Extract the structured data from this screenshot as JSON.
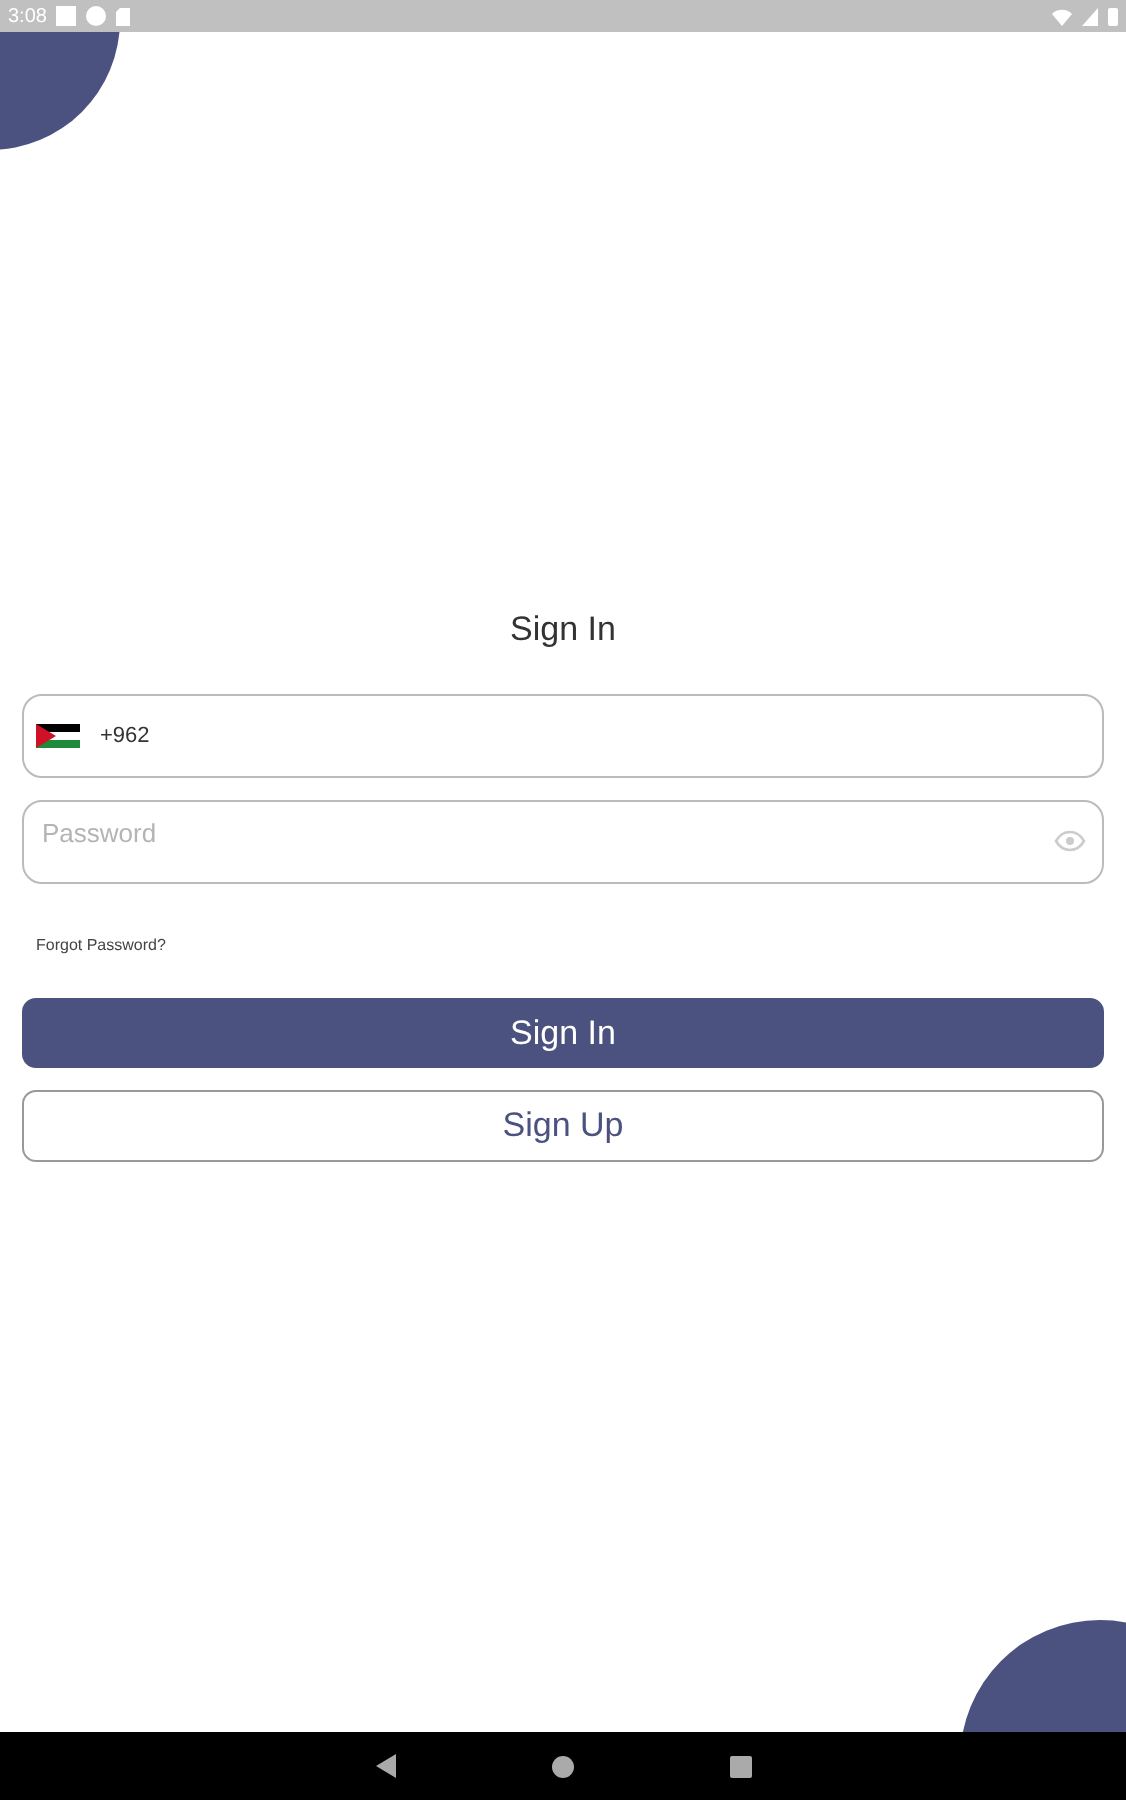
{
  "status_bar": {
    "time": "3:08"
  },
  "title": "Sign In",
  "phone_field": {
    "country_code": "+962"
  },
  "password_field": {
    "placeholder": "Password"
  },
  "forgot_link": "Forgot Password?",
  "buttons": [
    {
      "label": "Sign In",
      "kind": "primary"
    },
    {
      "label": "Sign Up",
      "kind": "secondary"
    }
  ]
}
